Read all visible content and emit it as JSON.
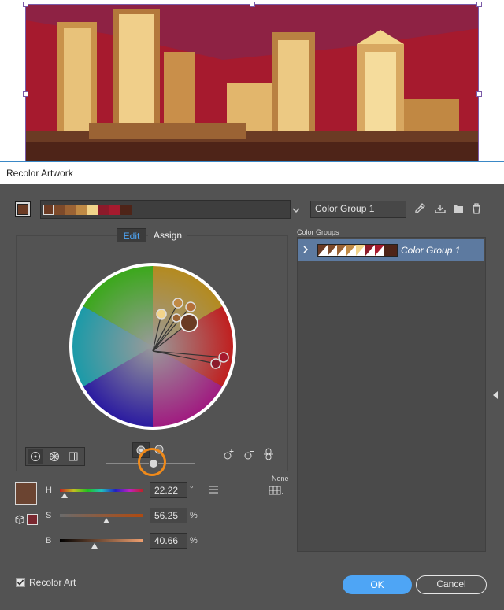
{
  "dialog": {
    "title": "Recolor Artwork"
  },
  "toolbar": {
    "color_group_name": "Color Group 1",
    "icons": [
      "eyedropper-icon",
      "save-group-icon",
      "folder-icon",
      "trash-icon"
    ]
  },
  "swatches": [
    "#6b3b24",
    "#7d4a2a",
    "#9b6334",
    "#c08a45",
    "#f2d48a",
    "#8c1a2a",
    "#a61a2e",
    "#4e2418"
  ],
  "current_color": "#6b4431",
  "tabs": {
    "edit": "Edit",
    "assign": "Assign"
  },
  "color_groups": {
    "header": "Color Groups",
    "items": [
      {
        "name": "Color Group 1"
      }
    ]
  },
  "hsb": {
    "h_label": "H",
    "h_value": "22.22",
    "h_unit": "°",
    "s_label": "S",
    "s_value": "56.25",
    "s_unit": "%",
    "b_label": "B",
    "b_value": "40.66",
    "b_unit": "%",
    "none_label": "None"
  },
  "footer": {
    "recolor_art_label": "Recolor Art",
    "recolor_checked": true,
    "ok_label": "OK",
    "cancel_label": "Cancel"
  },
  "colors": {
    "accent": "#4ea5f5",
    "highlight": "#f08a1a",
    "selected_row": "#5d7aa0"
  }
}
